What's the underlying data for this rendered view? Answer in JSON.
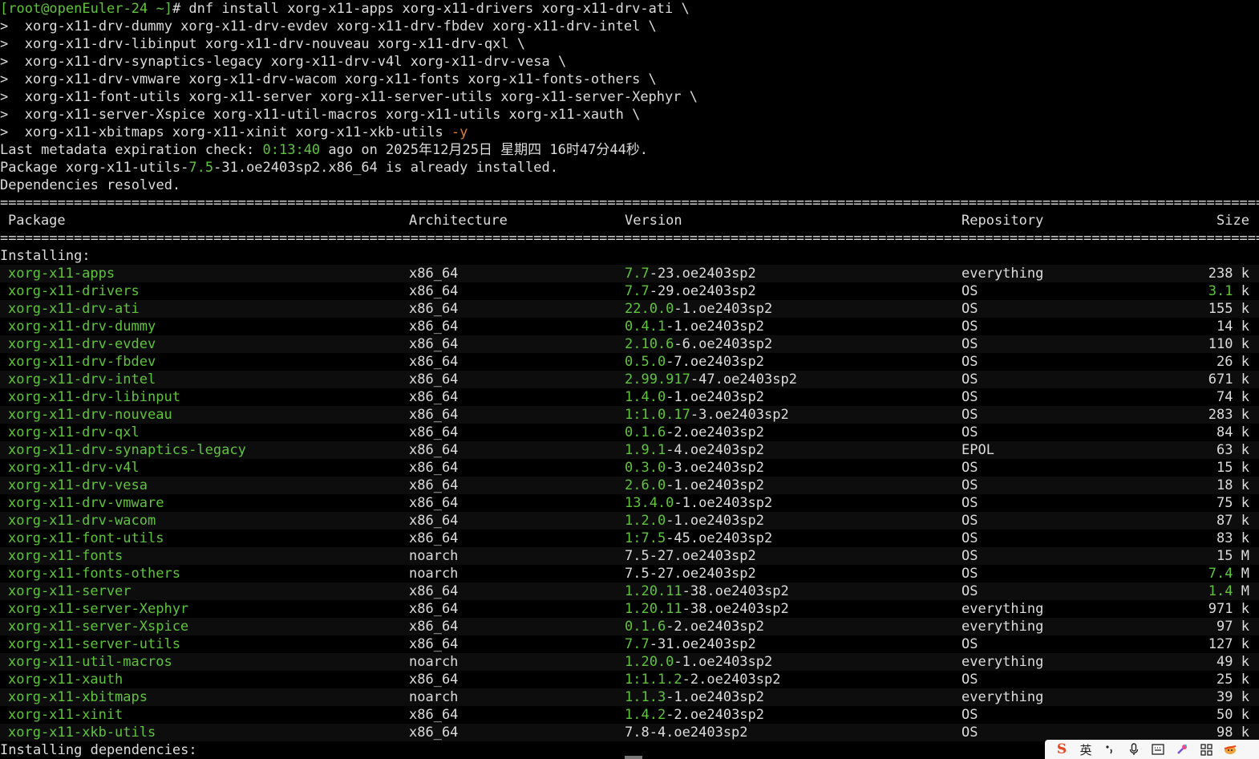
{
  "prompt": {
    "user_host": "[root@openEuler-24 ~]",
    "symbol": "#"
  },
  "command_lines": [
    " dnf install xorg-x11-apps xorg-x11-drivers xorg-x11-drv-ati \\",
    ">  xorg-x11-drv-dummy xorg-x11-drv-evdev xorg-x11-drv-fbdev xorg-x11-drv-intel \\",
    ">  xorg-x11-drv-libinput xorg-x11-drv-nouveau xorg-x11-drv-qxl \\",
    ">  xorg-x11-drv-synaptics-legacy xorg-x11-drv-v4l xorg-x11-drv-vesa \\",
    ">  xorg-x11-drv-vmware xorg-x11-drv-wacom xorg-x11-fonts xorg-x11-fonts-others \\",
    ">  xorg-x11-font-utils xorg-x11-server xorg-x11-server-utils xorg-x11-server-Xephyr \\",
    ">  xorg-x11-server-Xspice xorg-x11-util-macros xorg-x11-utils xorg-x11-xauth \\"
  ],
  "last_command_line": {
    "text": ">  xorg-x11-xbitmaps xorg-x11-xinit xorg-x11-xkb-utils ",
    "flag": "-y"
  },
  "metadata_line": {
    "prefix": "Last metadata expiration check: ",
    "elapsed": "0:13:40",
    "suffix": " ago on 2025年12月25日 星期四 16时47分44秒."
  },
  "installed_line": {
    "prefix": "Package xorg-x11-utils-",
    "version": "7.5",
    "suffix": "-31.oe2403sp2.x86_64 is already installed."
  },
  "resolved_line": "Dependencies resolved.",
  "separator": "==================================================================================================================================================================",
  "table_headers": {
    "package": "Package",
    "architecture": "Architecture",
    "version": "Version",
    "repository": "Repository",
    "size": "Size"
  },
  "installing_label": "Installing:",
  "packages": [
    {
      "name": "xorg-x11-apps",
      "arch": "x86_64",
      "ver_hl": "7.7",
      "ver_rest": "-23.oe2403sp2",
      "repo": "everything",
      "size_num": "238",
      "size_unit": " k",
      "size_hl": false
    },
    {
      "name": "xorg-x11-drivers",
      "arch": "x86_64",
      "ver_hl": "7.7",
      "ver_rest": "-29.oe2403sp2",
      "repo": "OS",
      "size_num": "3.1",
      "size_unit": " k",
      "size_hl": true
    },
    {
      "name": "xorg-x11-drv-ati",
      "arch": "x86_64",
      "ver_hl": "22.0.0",
      "ver_rest": "-1.oe2403sp2",
      "repo": "OS",
      "size_num": "155",
      "size_unit": " k",
      "size_hl": false
    },
    {
      "name": "xorg-x11-drv-dummy",
      "arch": "x86_64",
      "ver_hl": "0.4.1",
      "ver_rest": "-1.oe2403sp2",
      "repo": "OS",
      "size_num": "14",
      "size_unit": " k",
      "size_hl": false
    },
    {
      "name": "xorg-x11-drv-evdev",
      "arch": "x86_64",
      "ver_hl": "2.10.6",
      "ver_rest": "-6.oe2403sp2",
      "repo": "OS",
      "size_num": "110",
      "size_unit": " k",
      "size_hl": false
    },
    {
      "name": "xorg-x11-drv-fbdev",
      "arch": "x86_64",
      "ver_hl": "0.5.0",
      "ver_rest": "-7.oe2403sp2",
      "repo": "OS",
      "size_num": "26",
      "size_unit": " k",
      "size_hl": false
    },
    {
      "name": "xorg-x11-drv-intel",
      "arch": "x86_64",
      "ver_hl": "2.99.917",
      "ver_rest": "-47.oe2403sp2",
      "repo": "OS",
      "size_num": "671",
      "size_unit": " k",
      "size_hl": false
    },
    {
      "name": "xorg-x11-drv-libinput",
      "arch": "x86_64",
      "ver_hl": "1.4.0",
      "ver_rest": "-1.oe2403sp2",
      "repo": "OS",
      "size_num": "74",
      "size_unit": " k",
      "size_hl": false
    },
    {
      "name": "xorg-x11-drv-nouveau",
      "arch": "x86_64",
      "ver_hl": "1:1.0.17",
      "ver_rest": "-3.oe2403sp2",
      "repo": "OS",
      "size_num": "283",
      "size_unit": " k",
      "size_hl": false
    },
    {
      "name": "xorg-x11-drv-qxl",
      "arch": "x86_64",
      "ver_hl": "0.1.6",
      "ver_rest": "-2.oe2403sp2",
      "repo": "OS",
      "size_num": "84",
      "size_unit": " k",
      "size_hl": false
    },
    {
      "name": "xorg-x11-drv-synaptics-legacy",
      "arch": "x86_64",
      "ver_hl": "1.9.1",
      "ver_rest": "-4.oe2403sp2",
      "repo": "EPOL",
      "size_num": "63",
      "size_unit": " k",
      "size_hl": false
    },
    {
      "name": "xorg-x11-drv-v4l",
      "arch": "x86_64",
      "ver_hl": "0.3.0",
      "ver_rest": "-3.oe2403sp2",
      "repo": "OS",
      "size_num": "15",
      "size_unit": " k",
      "size_hl": false
    },
    {
      "name": "xorg-x11-drv-vesa",
      "arch": "x86_64",
      "ver_hl": "2.6.0",
      "ver_rest": "-1.oe2403sp2",
      "repo": "OS",
      "size_num": "18",
      "size_unit": " k",
      "size_hl": false
    },
    {
      "name": "xorg-x11-drv-vmware",
      "arch": "x86_64",
      "ver_hl": "13.4.0",
      "ver_rest": "-1.oe2403sp2",
      "repo": "OS",
      "size_num": "75",
      "size_unit": " k",
      "size_hl": false
    },
    {
      "name": "xorg-x11-drv-wacom",
      "arch": "x86_64",
      "ver_hl": "1.2.0",
      "ver_rest": "-1.oe2403sp2",
      "repo": "OS",
      "size_num": "87",
      "size_unit": " k",
      "size_hl": false
    },
    {
      "name": "xorg-x11-font-utils",
      "arch": "x86_64",
      "ver_hl": "1:7.5",
      "ver_rest": "-45.oe2403sp2",
      "repo": "OS",
      "size_num": "83",
      "size_unit": " k",
      "size_hl": false
    },
    {
      "name": "xorg-x11-fonts",
      "arch": "noarch",
      "ver_hl": "",
      "ver_rest": "7.5-27.oe2403sp2",
      "repo": "OS",
      "size_num": "15",
      "size_unit": " M",
      "size_hl": false
    },
    {
      "name": "xorg-x11-fonts-others",
      "arch": "noarch",
      "ver_hl": "",
      "ver_rest": "7.5-27.oe2403sp2",
      "repo": "OS",
      "size_num": "7.4",
      "size_unit": " M",
      "size_hl": true
    },
    {
      "name": "xorg-x11-server",
      "arch": "x86_64",
      "ver_hl": "1.20.11",
      "ver_rest": "-38.oe2403sp2",
      "repo": "OS",
      "size_num": "1.4",
      "size_unit": " M",
      "size_hl": true
    },
    {
      "name": "xorg-x11-server-Xephyr",
      "arch": "x86_64",
      "ver_hl": "1.20.11",
      "ver_rest": "-38.oe2403sp2",
      "repo": "everything",
      "size_num": "971",
      "size_unit": " k",
      "size_hl": false
    },
    {
      "name": "xorg-x11-server-Xspice",
      "arch": "x86_64",
      "ver_hl": "0.1.6",
      "ver_rest": "-2.oe2403sp2",
      "repo": "everything",
      "size_num": "97",
      "size_unit": " k",
      "size_hl": false
    },
    {
      "name": "xorg-x11-server-utils",
      "arch": "x86_64",
      "ver_hl": "7.7",
      "ver_rest": "-31.oe2403sp2",
      "repo": "OS",
      "size_num": "127",
      "size_unit": " k",
      "size_hl": false
    },
    {
      "name": "xorg-x11-util-macros",
      "arch": "noarch",
      "ver_hl": "1.20.0",
      "ver_rest": "-1.oe2403sp2",
      "repo": "everything",
      "size_num": "49",
      "size_unit": " k",
      "size_hl": false
    },
    {
      "name": "xorg-x11-xauth",
      "arch": "x86_64",
      "ver_hl": "1:1.1.2",
      "ver_rest": "-2.oe2403sp2",
      "repo": "OS",
      "size_num": "25",
      "size_unit": " k",
      "size_hl": false
    },
    {
      "name": "xorg-x11-xbitmaps",
      "arch": "noarch",
      "ver_hl": "1.1.3",
      "ver_rest": "-1.oe2403sp2",
      "repo": "everything",
      "size_num": "39",
      "size_unit": " k",
      "size_hl": false
    },
    {
      "name": "xorg-x11-xinit",
      "arch": "x86_64",
      "ver_hl": "1.4.2",
      "ver_rest": "-2.oe2403sp2",
      "repo": "OS",
      "size_num": "50",
      "size_unit": " k",
      "size_hl": false
    },
    {
      "name": "xorg-x11-xkb-utils",
      "arch": "x86_64",
      "ver_hl": "",
      "ver_rest": "7.8-4.oe2403sp2",
      "repo": "OS",
      "size_num": "98",
      "size_unit": " k",
      "size_hl": false
    }
  ],
  "dependencies_label": "Installing dependencies:",
  "ime_bar": {
    "logo": "S",
    "mode": "英",
    "icons": [
      "punctuation-icon",
      "microphone-icon",
      "keyboard-icon",
      "skin-icon",
      "toolbox-icon",
      "mascot-icon"
    ]
  },
  "colors": {
    "background": "#000000",
    "text": "#dcdcdc",
    "highlight_green": "#5ec43a",
    "flag_orange": "#e07b32",
    "ime_logo": "#e8451c"
  }
}
